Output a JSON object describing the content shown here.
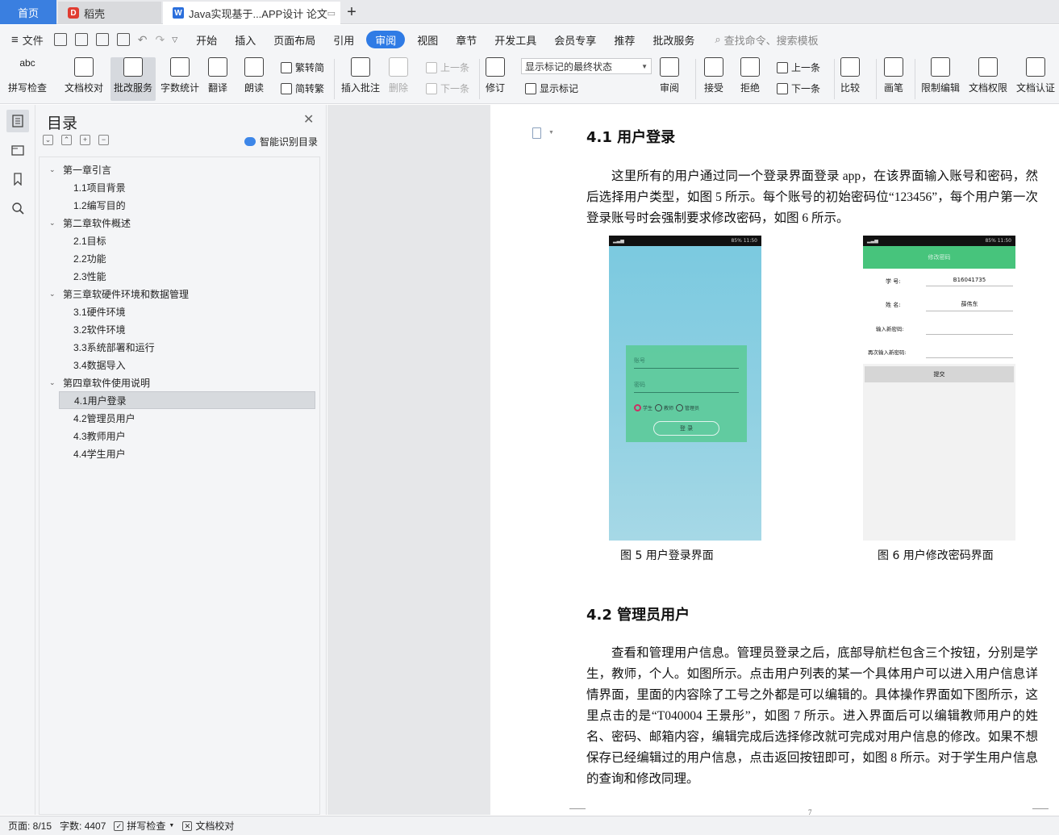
{
  "tabs": {
    "home": "首页",
    "daoke": "稻壳",
    "doc": "Java实现基于...APP设计 论文"
  },
  "menu": {
    "file": "文件",
    "items": [
      "开始",
      "插入",
      "页面布局",
      "引用",
      "审阅",
      "视图",
      "章节",
      "开发工具",
      "会员专享",
      "推荐",
      "批改服务"
    ],
    "active": "审阅",
    "search": "查找命令、搜索模板"
  },
  "ribbon": {
    "spell_check": "拼写检查",
    "doc_proof": "文档校对",
    "correction": "批改服务",
    "word_count": "字数统计",
    "translate": "翻译",
    "read_aloud": "朗读",
    "trad_to_simp": "繁转简",
    "simp_to_trad": "简转繁",
    "insert_comment": "插入批注",
    "delete": "删除",
    "prev": "上一条",
    "next": "下一条",
    "revise": "修订",
    "display_select": "显示标记的最终状态",
    "show_markup": "显示标记",
    "review": "审阅",
    "accept": "接受",
    "reject": "拒绝",
    "prev2": "上一条",
    "next2": "下一条",
    "compare": "比较",
    "pen": "画笔",
    "restrict_edit": "限制编辑",
    "doc_permission": "文档权限",
    "doc_cert": "文档认证"
  },
  "toc": {
    "title": "目录",
    "smart": "智能识别目录",
    "items": [
      {
        "level": 1,
        "text": "第一章引言"
      },
      {
        "level": 2,
        "text": "1.1项目背景"
      },
      {
        "level": 2,
        "text": "1.2编写目的"
      },
      {
        "level": 1,
        "text": "第二章软件概述"
      },
      {
        "level": 2,
        "text": "2.1目标"
      },
      {
        "level": 2,
        "text": "2.2功能"
      },
      {
        "level": 2,
        "text": "2.3性能"
      },
      {
        "level": 1,
        "text": "第三章软硬件环境和数据管理"
      },
      {
        "level": 2,
        "text": "3.1硬件环境"
      },
      {
        "level": 2,
        "text": "3.2软件环境"
      },
      {
        "level": 2,
        "text": "3.3系统部署和运行"
      },
      {
        "level": 2,
        "text": "3.4数据导入"
      },
      {
        "level": 1,
        "text": "第四章软件使用说明"
      },
      {
        "level": 2,
        "text": "4.1用户登录",
        "selected": true
      },
      {
        "level": 2,
        "text": "4.2管理员用户"
      },
      {
        "level": 2,
        "text": "4.3教师用户"
      },
      {
        "level": 2,
        "text": "4.4学生用户"
      }
    ]
  },
  "doc": {
    "h41": "4.1  用户登录",
    "p1": "这里所有的用户通过同一个登录界面登录 app，在该界面输入账号和密码，然后选择用户类型，如图 5 所示。每个账号的初始密码位“123456”，每个用户第一次登录账号时会强制要求修改密码，如图 6 所示。",
    "fig5": {
      "status_right": "85% 11:50",
      "account_ph": "账号",
      "password_ph": "密码",
      "radio_student": "学生",
      "radio_teacher": "教师",
      "radio_admin": "管理员",
      "login_btn": "登 录",
      "caption": "图 5    用户登录界面"
    },
    "fig6": {
      "status_right": "85% 11:50",
      "header": "修改密码",
      "label_id": "学  号:",
      "value_id": "B16041735",
      "label_name": "姓  名:",
      "value_name": "薛伟东",
      "label_new": "输入新密码:",
      "label_repeat": "再次输入新密码:",
      "submit": "提交",
      "caption": "图 6    用户修改密码界面"
    },
    "h42": "4.2  管理员用户",
    "p2": "查看和管理用户信息。管理员登录之后，底部导航栏包含三个按钮，分别是学生，教师，个人。如图所示。点击用户列表的某一个具体用户可以进入用户信息详情界面，里面的内容除了工号之外都是可以编辑的。具体操作界面如下图所示，这里点击的是“T040004  王景彤”，如图 7 所示。进入界面后可以编辑教师用户的姓名、密码、邮箱内容，编辑完成后选择修改就可完成对用户信息的修改。如果不想保存已经编辑过的用户信息，点击返回按钮即可，如图 8 所示。对于学生用户信息的查询和修改同理。",
    "page_number": "7"
  },
  "status": {
    "page": "页面: 8/15",
    "words": "字数: 4407",
    "spell": "拼写检查",
    "proof": "文档校对"
  }
}
